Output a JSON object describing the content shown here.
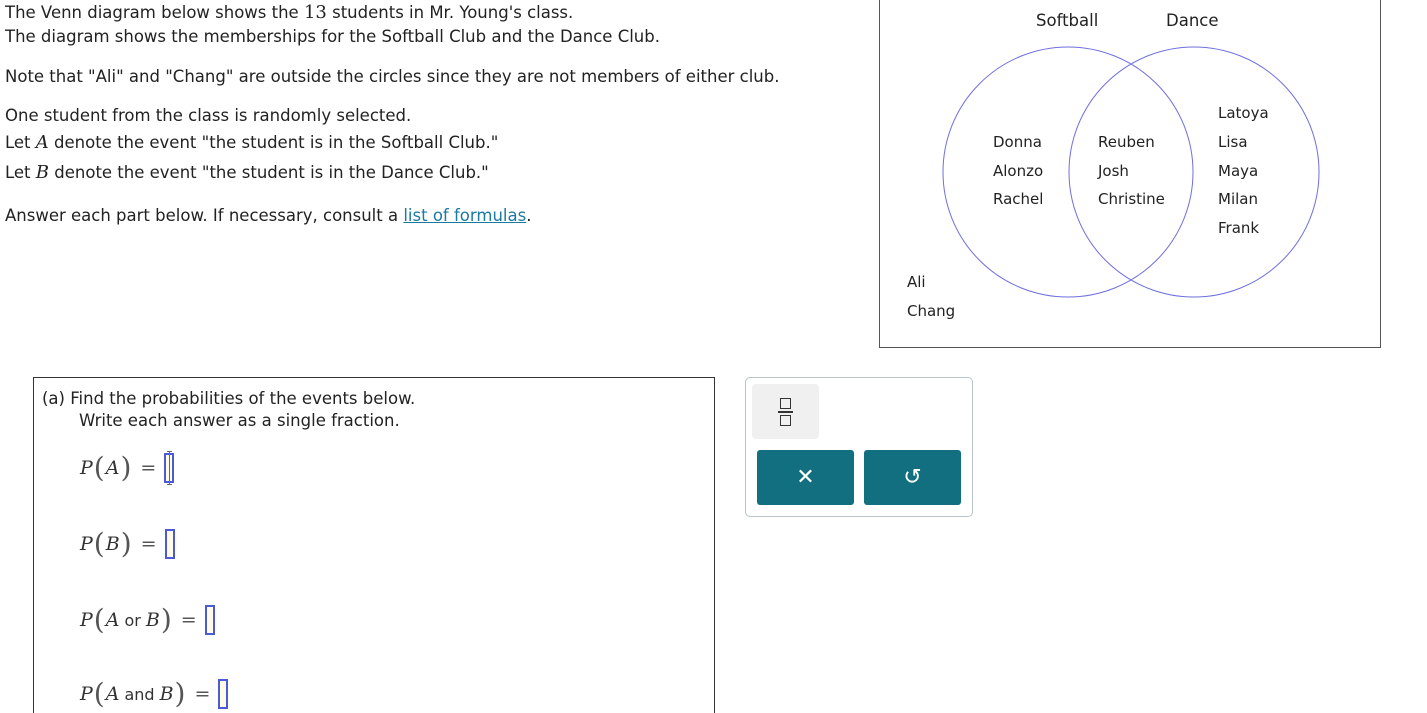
{
  "problem": {
    "line1_pre": "The Venn diagram below shows the ",
    "line1_num": "13",
    "line1_post": " students in Mr. Young's class.",
    "line2": "The diagram shows the memberships for the Softball Club and the Dance Club.",
    "line3": "Note that \"Ali\" and \"Chang\" are outside the circles since they are not members of either club.",
    "line4": "One student from the class is randomly selected.",
    "line5_pre": "Let ",
    "line5_var": "A",
    "line5_post": " denote the event \"the student is in the Softball Club.\"",
    "line6_pre": "Let ",
    "line6_var": "B",
    "line6_post": " denote the event \"the student is in the Dance Club.\"",
    "line7_pre": "Answer each part below. If necessary, consult a ",
    "line7_link": "list of formulas",
    "line7_post": "."
  },
  "venn": {
    "softball_label": "Softball",
    "dance_label": "Dance",
    "softball_only": [
      "Donna",
      "Alonzo",
      "Rachel"
    ],
    "both": [
      "Reuben",
      "Josh",
      "Christine"
    ],
    "dance_only": [
      "Latoya",
      "Lisa",
      "Maya",
      "Milan",
      "Frank"
    ],
    "neither": [
      "Ali",
      "Chang"
    ],
    "circle_color": "#6f6fe0"
  },
  "part_a": {
    "line1": "(a) Find the probabilities of the events below.",
    "line2": "Write each answer as a single fraction.",
    "eq1": {
      "P": "P",
      "var": "A"
    },
    "eq2": {
      "P": "P",
      "var": "B"
    },
    "eq3": {
      "P": "P",
      "var1": "A",
      "word": "or",
      "var2": "B"
    },
    "eq4": {
      "P": "P",
      "var1": "A",
      "word": "and",
      "var2": "B"
    },
    "equals": "="
  },
  "tools": {
    "fraction_icon": "fraction-icon",
    "clear_glyph": "✕",
    "undo_glyph": "↺",
    "accent": "#116f7f"
  }
}
